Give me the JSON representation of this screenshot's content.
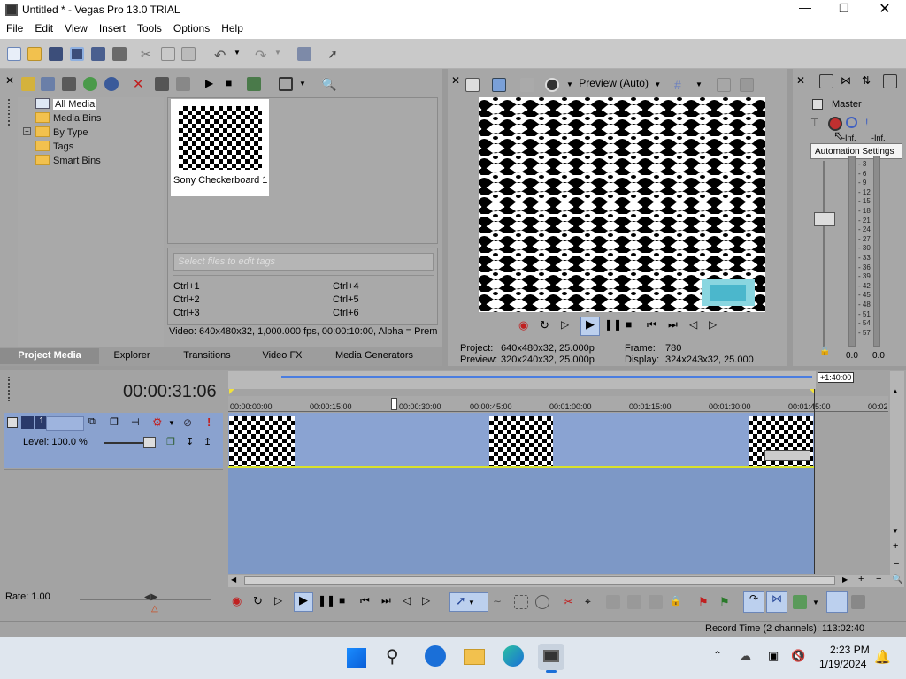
{
  "window": {
    "title": "Untitled * - Vegas Pro 13.0 TRIAL"
  },
  "menu": [
    "File",
    "Edit",
    "View",
    "Insert",
    "Tools",
    "Options",
    "Help"
  ],
  "media_tree": {
    "items": [
      "All Media",
      "Media Bins",
      "By Type",
      "Tags",
      "Smart Bins"
    ],
    "expander": "+"
  },
  "media_thumb": {
    "label": "Sony Checkerboard 1"
  },
  "tags": {
    "placeholder": "Select files to edit tags",
    "shortcuts": [
      "Ctrl+1",
      "Ctrl+4",
      "Ctrl+2",
      "Ctrl+5",
      "Ctrl+3",
      "Ctrl+6"
    ]
  },
  "media_info": "Video: 640x480x32, 1,000.000 fps, 00:00:10:00, Alpha = Prem",
  "tabs": [
    "Project Media",
    "Explorer",
    "Transitions",
    "Video FX",
    "Media Generators"
  ],
  "preview": {
    "mode": "Preview (Auto)",
    "project_label": "Project:",
    "project_value": "640x480x32, 25.000p",
    "preview_label": "Preview:",
    "preview_value": "320x240x32, 25.000p",
    "frame_label": "Frame:",
    "frame_value": "780",
    "display_label": "Display:",
    "display_value": "324x243x32, 25.000"
  },
  "master": {
    "title": "Master",
    "tooltip": "Automation Settings",
    "left_db": "-Inf.",
    "right_db": "-Inf.",
    "bottom_left": "0.0",
    "bottom_right": "0.0",
    "scale": [
      "3",
      "6",
      "9",
      "12",
      "15",
      "18",
      "21",
      "24",
      "27",
      "30",
      "33",
      "36",
      "39",
      "42",
      "45",
      "48",
      "51",
      "54",
      "57"
    ]
  },
  "timeline": {
    "timecode": "00:00:31:06",
    "region_end": "+1:40:00",
    "ruler": [
      "00:00:00:00",
      "00:00:15:00",
      "00:00:30:00",
      "00:00:45:00",
      "00:01:00:00",
      "00:01:15:00",
      "00:01:30:00",
      "00:01:45:00",
      "00:02"
    ],
    "track_number": "1",
    "level": "Level: 100.0 %",
    "rate": "Rate: 1.00",
    "record_time": "Record Time (2 channels): 113:02:40"
  },
  "taskbar": {
    "time": "2:23 PM",
    "date": "1/19/2024"
  }
}
